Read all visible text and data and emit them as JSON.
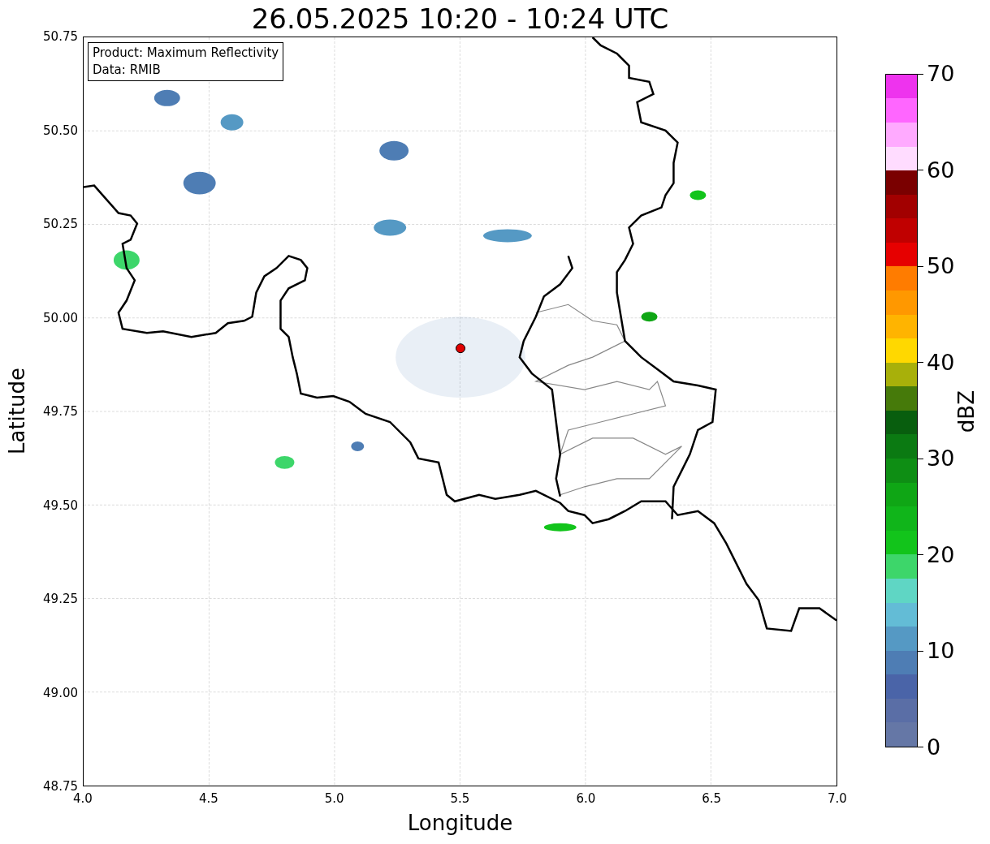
{
  "title": "26.05.2025 10:20 - 10:24 UTC",
  "legend_box": {
    "lines": [
      "Product: Maximum Reflectivity",
      "Data: RMIB"
    ]
  },
  "x_axis": {
    "label": "Longitude",
    "ticks": [
      "4.0",
      "4.5",
      "5.0",
      "5.5",
      "6.0",
      "6.5",
      "7.0"
    ]
  },
  "y_axis": {
    "label": "Latitude",
    "ticks": [
      "50.75",
      "50.50",
      "50.25",
      "50.00",
      "49.75",
      "49.50",
      "49.25",
      "49.00",
      "48.75"
    ]
  },
  "colorbar": {
    "label": "dBZ",
    "ticks": [
      "70",
      "60",
      "50",
      "40",
      "30",
      "20",
      "10",
      "0"
    ],
    "segments": [
      {
        "color": "#6577a6"
      },
      {
        "color": "#5a6ea6"
      },
      {
        "color": "#4a64a8"
      },
      {
        "color": "#4e7db4"
      },
      {
        "color": "#5599c4"
      },
      {
        "color": "#63bcd6"
      },
      {
        "color": "#5fd6c4"
      },
      {
        "color": "#3dd66a"
      },
      {
        "color": "#12c41b"
      },
      {
        "color": "#10b51a"
      },
      {
        "color": "#0fa615"
      },
      {
        "color": "#0e8e14"
      },
      {
        "color": "#0b7a12"
      },
      {
        "color": "#085e0e"
      },
      {
        "color": "#467a0a"
      },
      {
        "color": "#a8b00a"
      },
      {
        "color": "#ffd800"
      },
      {
        "color": "#ffb400"
      },
      {
        "color": "#ff9800"
      },
      {
        "color": "#ff7c00"
      },
      {
        "color": "#e60000"
      },
      {
        "color": "#c00000"
      },
      {
        "color": "#a20000"
      },
      {
        "color": "#7a0000"
      },
      {
        "color": "#ffdcff"
      },
      {
        "color": "#ffaaff"
      },
      {
        "color": "#ff66ff"
      },
      {
        "color": "#ee33ee"
      }
    ]
  }
}
